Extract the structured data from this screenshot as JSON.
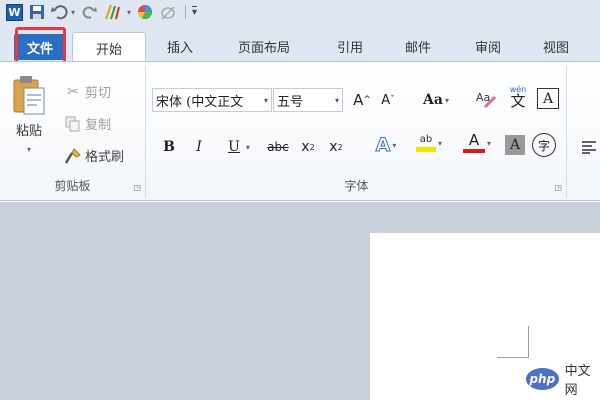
{
  "qat": {
    "app_letter": "W",
    "more": "▾"
  },
  "tabs": [
    "文件",
    "开始",
    "插入",
    "页面布局",
    "引用",
    "邮件",
    "审阅",
    "视图"
  ],
  "clipboard": {
    "paste": "粘贴",
    "cut": "剪切",
    "copy": "复制",
    "format_painter": "格式刷",
    "group_label": "剪贴板"
  },
  "font": {
    "font_name": "宋体 (中文正文",
    "font_size": "五号",
    "grow": "A",
    "shrink": "A",
    "change_case": "Aa",
    "bold": "B",
    "italic": "I",
    "underline": "U",
    "strikethrough": "abc",
    "subscript": "x",
    "superscript": "x",
    "text_effects": "A",
    "highlight": "ab",
    "font_color": "A",
    "char_shading": "A",
    "enclose": "字",
    "phonetic": "wén",
    "phonetic_char": "文",
    "border": "A",
    "group_label": "字体"
  },
  "watermark": {
    "logo": "php",
    "text": "中文网"
  },
  "colors": {
    "file_tab": "#2a6fc4",
    "highlight_box": "#e8393f",
    "font_color_bar": "#d21e1e",
    "highlight_bar": "#f5e400"
  }
}
